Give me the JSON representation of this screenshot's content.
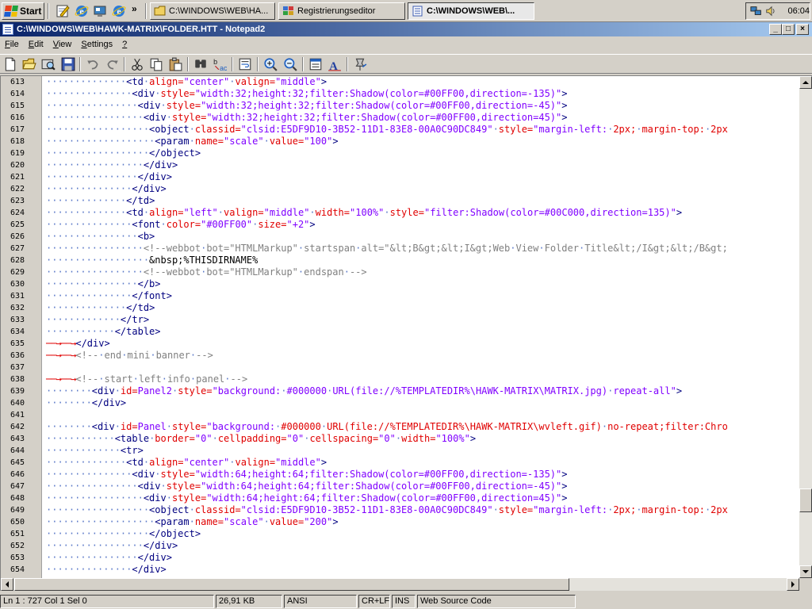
{
  "taskbar": {
    "start_label": "Start",
    "quicklaunch_more": "»",
    "tasks": [
      {
        "label": "C:\\WINDOWS\\WEB\\HA...",
        "icon": "folder-icon"
      },
      {
        "label": "Registrierungseditor",
        "icon": "regedit-icon"
      },
      {
        "label": "C:\\WINDOWS\\WEB\\...",
        "icon": "notepad-icon"
      }
    ],
    "clock": "06:04"
  },
  "window": {
    "title": "C:\\WINDOWS\\WEB\\HAWK-MATRIX\\FOLDER.HTT - Notepad2",
    "minimize": "_",
    "maximize": "□",
    "close": "×"
  },
  "menu": [
    {
      "label": "File",
      "key": "F",
      "rest": "ile"
    },
    {
      "label": "Edit",
      "key": "E",
      "rest": "dit"
    },
    {
      "label": "View",
      "key": "V",
      "rest": "iew"
    },
    {
      "label": "Settings",
      "key": "S",
      "rest": "ettings"
    },
    {
      "label": "?",
      "key": "?",
      "rest": ""
    }
  ],
  "editor": {
    "lines": [
      {
        "n": "613",
        "ind": 14,
        "t": "<td align=\"center\" valign=\"middle\">"
      },
      {
        "n": "614",
        "ind": 15,
        "t": "<div style=\"width:32;height:32;filter:Shadow(color=#00FF00,direction=-135)\">"
      },
      {
        "n": "615",
        "ind": 16,
        "t": "<div style=\"width:32;height:32;filter:Shadow(color=#00FF00,direction=-45)\">"
      },
      {
        "n": "616",
        "ind": 17,
        "t": "<div style=\"width:32;height:32;filter:Shadow(color=#00FF00,direction=45)\">"
      },
      {
        "n": "617",
        "ind": 18,
        "t": "<object classid=\"clsid:E5DF9D10-3B52-11D1-83E8-00A0C90DC849\" style=\"margin-left: 2px; margin-top: 2px"
      },
      {
        "n": "618",
        "ind": 19,
        "t": "<param name=\"scale\" value=\"100\">"
      },
      {
        "n": "619",
        "ind": 18,
        "t": "</object>"
      },
      {
        "n": "620",
        "ind": 17,
        "t": "</div>"
      },
      {
        "n": "621",
        "ind": 16,
        "t": "</div>"
      },
      {
        "n": "622",
        "ind": 15,
        "t": "</div>"
      },
      {
        "n": "623",
        "ind": 14,
        "t": "</td>"
      },
      {
        "n": "624",
        "ind": 14,
        "t": "<td align=\"left\" valign=\"middle\" width=\"100%\" style=\"filter:Shadow(color=#00C000,direction=135)\">"
      },
      {
        "n": "625",
        "ind": 15,
        "t": "<font color=\"#00FF00\" size=\"+2\">"
      },
      {
        "n": "626",
        "ind": 16,
        "t": "<b>"
      },
      {
        "n": "627",
        "ind": 17,
        "t": "<!--webbot bot=\"HTMLMarkup\" startspan alt=\"&lt;B&gt;&lt;I&gt;Web View Folder Title&lt;/I&gt;&lt;/B&gt;"
      },
      {
        "n": "628",
        "ind": 18,
        "t": "&nbsp;%THISDIRNAME%"
      },
      {
        "n": "629",
        "ind": 17,
        "t": "<!--webbot bot=\"HTMLMarkup\" endspan -->"
      },
      {
        "n": "630",
        "ind": 16,
        "t": "</b>"
      },
      {
        "n": "631",
        "ind": 15,
        "t": "</font>"
      },
      {
        "n": "632",
        "ind": 14,
        "t": "</td>"
      },
      {
        "n": "633",
        "ind": 13,
        "t": "</tr>"
      },
      {
        "n": "634",
        "ind": 12,
        "t": "</table>"
      },
      {
        "n": "635",
        "ind": 0,
        "arrows": 2,
        "t": "</div>"
      },
      {
        "n": "636",
        "ind": 0,
        "arrows": 2,
        "t": "<!-- end mini banner -->"
      },
      {
        "n": "637",
        "ind": 0,
        "t": ""
      },
      {
        "n": "638",
        "ind": 0,
        "arrows": 2,
        "t": "<!-- start left info panel -->"
      },
      {
        "n": "639",
        "ind": 8,
        "t": "<div id=Panel2 style=\"background: #000000 URL(file://%TEMPLATEDIR%\\HAWK-MATRIX\\MATRIX.jpg) repeat-all\">"
      },
      {
        "n": "640",
        "ind": 8,
        "t": "</div>"
      },
      {
        "n": "641",
        "ind": 0,
        "t": ""
      },
      {
        "n": "642",
        "ind": 8,
        "t": "<div id=Panel style=\"background: #000000 URL(file://%TEMPLATEDIR%\\HAWK-MATRIX\\wvleft.gif) no-repeat;filter:Chro"
      },
      {
        "n": "643",
        "ind": 12,
        "t": "<table border=\"0\" cellpadding=\"0\" cellspacing=\"0\" width=\"100%\">"
      },
      {
        "n": "644",
        "ind": 13,
        "t": "<tr>"
      },
      {
        "n": "645",
        "ind": 14,
        "t": "<td align=\"center\" valign=\"middle\">"
      },
      {
        "n": "646",
        "ind": 15,
        "t": "<div style=\"width:64;height:64;filter:Shadow(color=#00FF00,direction=-135)\">"
      },
      {
        "n": "647",
        "ind": 16,
        "t": "<div style=\"width:64;height:64;filter:Shadow(color=#00FF00,direction=-45)\">"
      },
      {
        "n": "648",
        "ind": 17,
        "t": "<div style=\"width:64;height:64;filter:Shadow(color=#00FF00,direction=45)\">"
      },
      {
        "n": "649",
        "ind": 18,
        "t": "<object classid=\"clsid:E5DF9D10-3B52-11D1-83E8-00A0C90DC849\" style=\"margin-left: 2px; margin-top: 2px"
      },
      {
        "n": "650",
        "ind": 19,
        "t": "<param name=\"scale\" value=\"200\">"
      },
      {
        "n": "651",
        "ind": 18,
        "t": "</object>"
      },
      {
        "n": "652",
        "ind": 17,
        "t": "</div>"
      },
      {
        "n": "653",
        "ind": 16,
        "t": "</div>"
      },
      {
        "n": "654",
        "ind": 15,
        "t": "</div>"
      }
    ]
  },
  "status": {
    "position": "Ln 1 : 727   Col 1   Sel 0",
    "size": "26,91 KB",
    "encoding": "ANSI",
    "eol": "CR+LF",
    "ovr": "INS",
    "lexer": "Web Source Code"
  },
  "colors": {
    "tag": "#000080",
    "attribute": "#e00000",
    "value": "#8000ff",
    "comment": "#808080",
    "whitespace_marker": "#5a78c8",
    "arrow": "#e00000"
  }
}
